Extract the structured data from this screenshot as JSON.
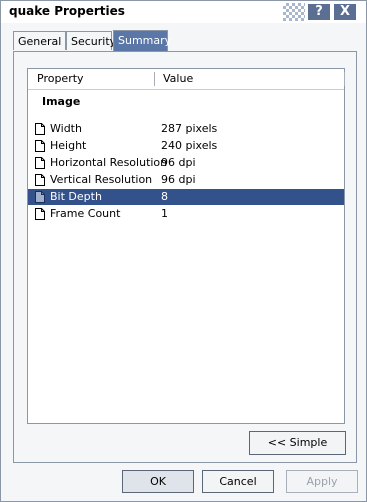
{
  "window": {
    "title": "quake Properties"
  },
  "title_buttons": {
    "help": "?",
    "close": "X"
  },
  "tabs": [
    {
      "label": "General"
    },
    {
      "label": "Security"
    },
    {
      "label": "Summary"
    }
  ],
  "list": {
    "headers": {
      "property": "Property",
      "value": "Value"
    },
    "group": "Image",
    "rows": [
      {
        "name": "Width",
        "value": "287 pixels"
      },
      {
        "name": "Height",
        "value": "240 pixels"
      },
      {
        "name": "Horizontal Resolution",
        "value": "96 dpi"
      },
      {
        "name": "Vertical Resolution",
        "value": "96 dpi"
      },
      {
        "name": "Bit Depth",
        "value": "8"
      },
      {
        "name": "Frame Count",
        "value": "1"
      }
    ]
  },
  "buttons": {
    "simple": "<< Simple",
    "ok": "OK",
    "cancel": "Cancel",
    "apply": "Apply"
  }
}
